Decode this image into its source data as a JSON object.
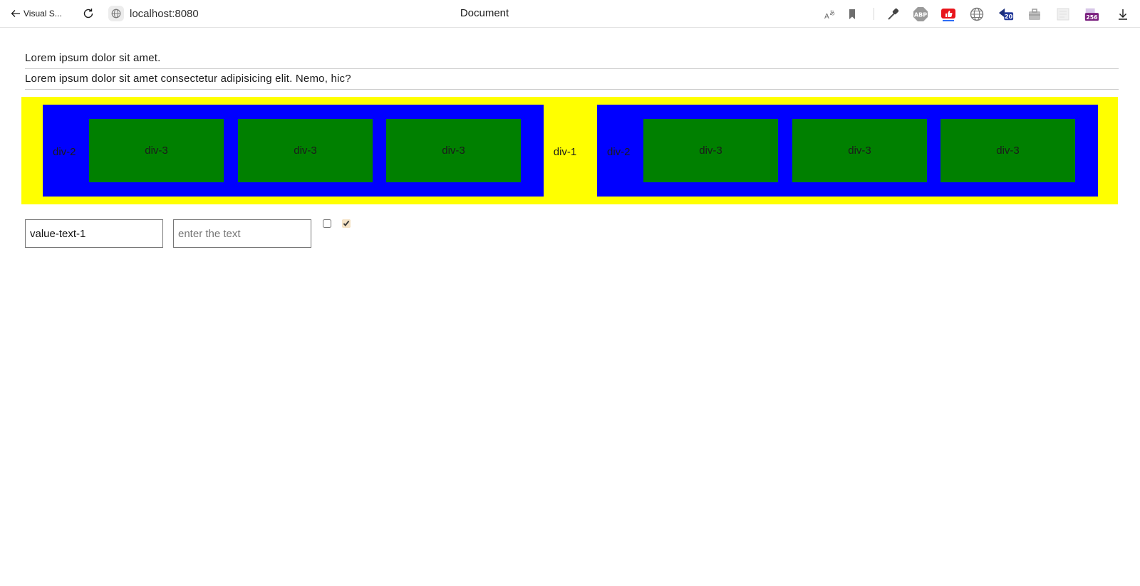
{
  "browser": {
    "back_label": "Visual S...",
    "url": "localhost:8080",
    "tab_title": "Document",
    "toolbar_icons": [
      "read-aloud-icon",
      "bookmark-icon",
      "eyedropper-icon",
      "adblock-icon",
      "youtube-like-icon",
      "globe-icon",
      "extension-badge-20-icon",
      "briefcase-icon",
      "blank-extension-icon",
      "extension-badge-256-icon",
      "download-icon"
    ],
    "badges": {
      "badge_1": "20",
      "badge_2": "256"
    },
    "adblock_label": "ABP"
  },
  "page": {
    "paragraph_1": "Lorem ipsum dolor sit amet.",
    "paragraph_2": "Lorem ipsum dolor sit amet consectetur adipisicing elit. Nemo, hic?",
    "outer_box": {
      "label": "div-1",
      "color": "#ffff00"
    },
    "inner_boxes": [
      {
        "label": "div-2",
        "color": "#0000ff",
        "children": [
          {
            "label": "div-3",
            "color": "#008000"
          },
          {
            "label": "div-3",
            "color": "#008000"
          },
          {
            "label": "div-3",
            "color": "#008000"
          }
        ]
      },
      {
        "label": "div-2",
        "color": "#0000ff",
        "children": [
          {
            "label": "div-3",
            "color": "#008000"
          },
          {
            "label": "div-3",
            "color": "#008000"
          },
          {
            "label": "div-3",
            "color": "#008000"
          }
        ]
      }
    ],
    "text_input_1": {
      "value": "value-text-1",
      "placeholder": ""
    },
    "text_input_2": {
      "value": "",
      "placeholder": "enter the text"
    },
    "checkbox_1": {
      "checked": false
    },
    "checkbox_2": {
      "checked": true
    }
  }
}
